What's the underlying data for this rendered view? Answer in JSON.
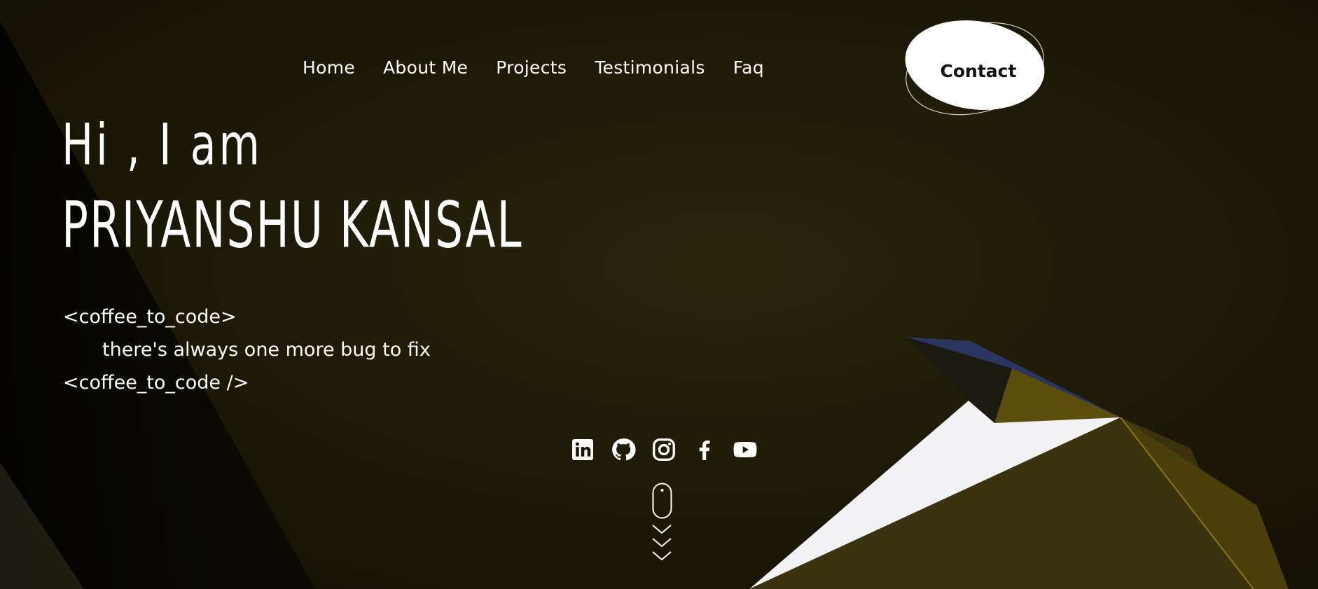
{
  "nav": {
    "items": [
      "Home",
      "About Me",
      "Projects",
      "Testimonials",
      "Faq"
    ],
    "contact_label": "Contact"
  },
  "hero": {
    "greeting": "Hi , I am",
    "name": "PRIYANSHU KANSAL",
    "code_open": "<coffee_to_code>",
    "code_body": "there's always one more bug to fix",
    "code_close": "<coffee_to_code />"
  },
  "socials": [
    "linkedin-icon",
    "github-icon",
    "instagram-icon",
    "facebook-icon",
    "youtube-icon"
  ],
  "colors": {
    "background": "#181407",
    "accent_gold": "#5c4e0c",
    "accent_blue": "#2a3560",
    "text": "#ffffff",
    "contact_bg": "#ffffff"
  }
}
